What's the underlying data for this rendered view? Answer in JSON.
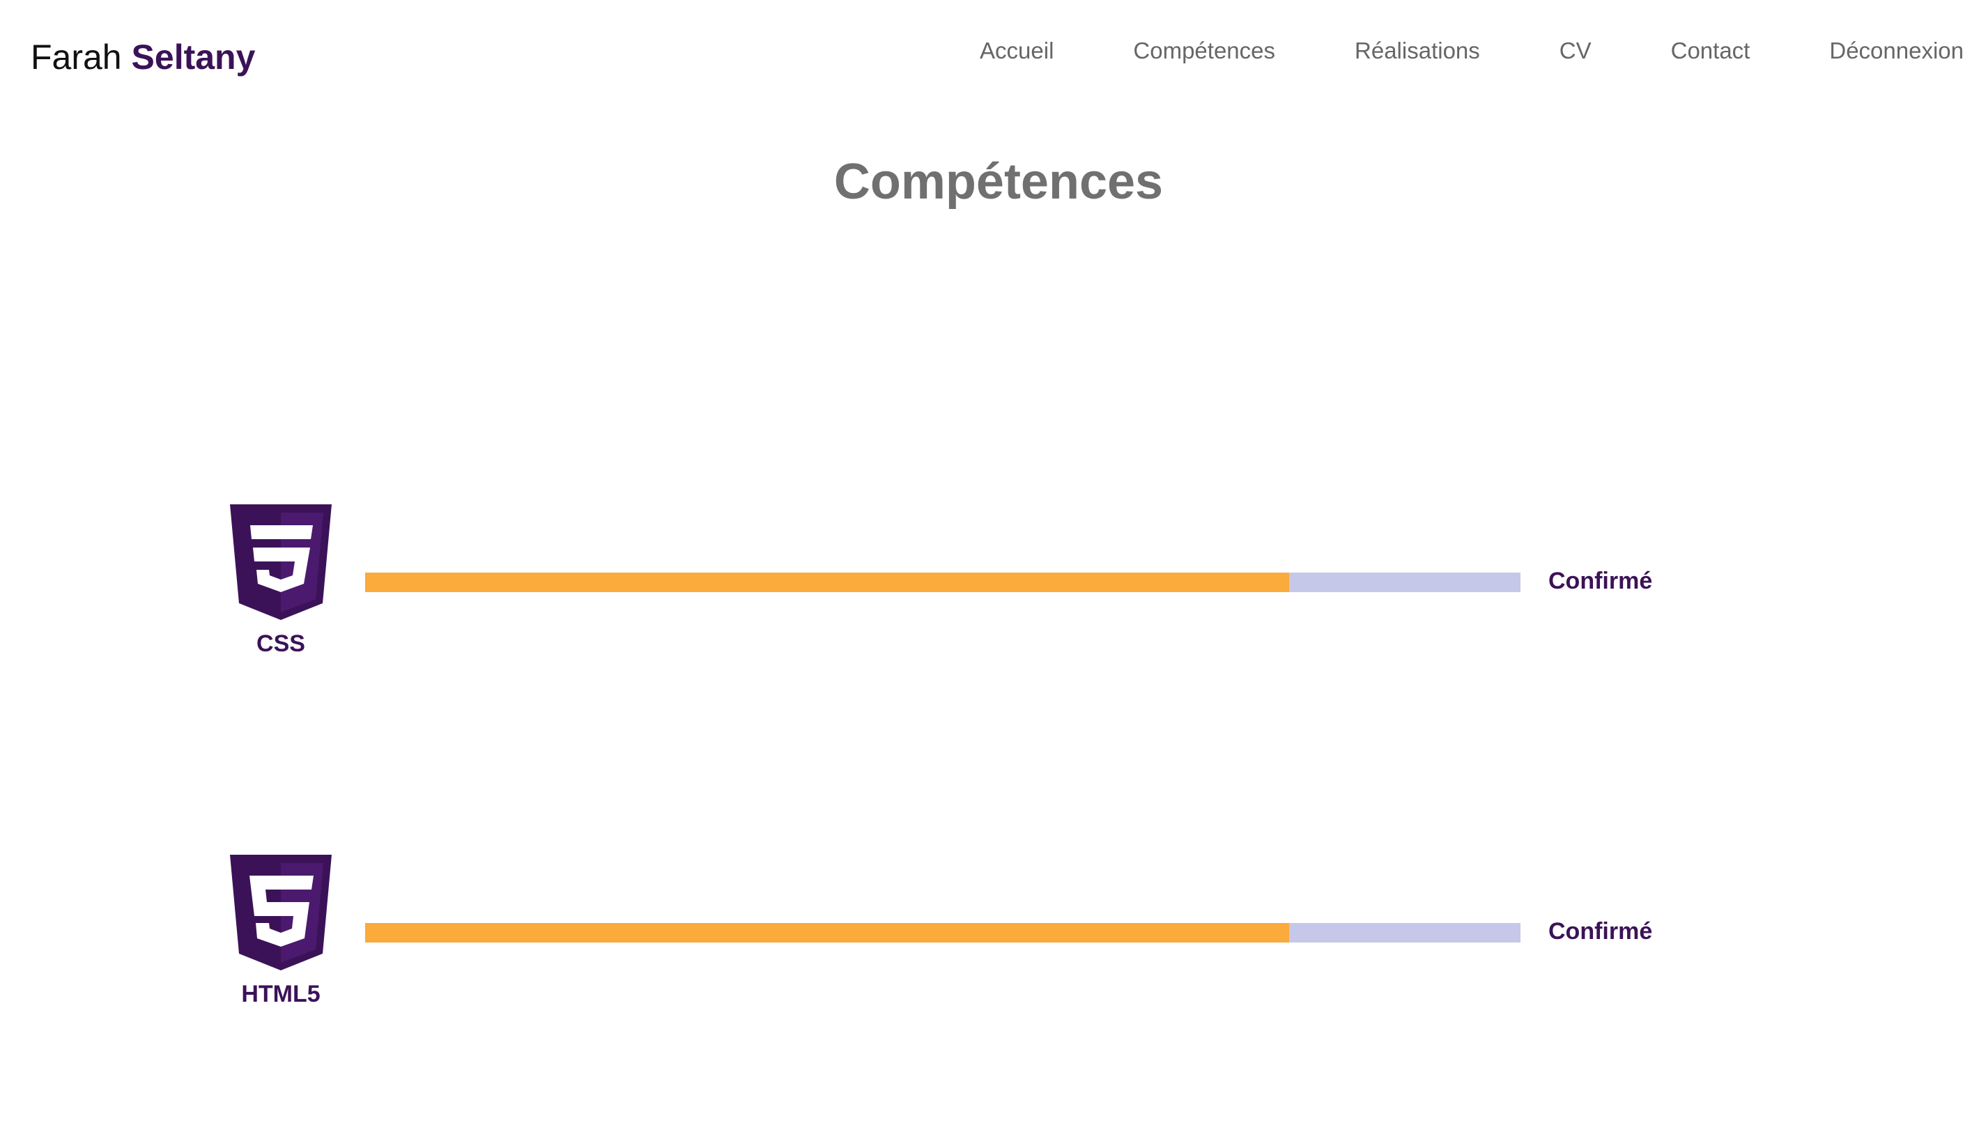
{
  "header": {
    "brand_first": "Farah",
    "brand_last": "Seltany",
    "nav": [
      {
        "label": "Accueil"
      },
      {
        "label": "Compétences"
      },
      {
        "label": "Réalisations"
      },
      {
        "label": "CV"
      },
      {
        "label": "Contact"
      },
      {
        "label": "Déconnexion"
      }
    ]
  },
  "main": {
    "title": "Compétences",
    "skills": [
      {
        "name": "CSS",
        "icon": "css3-icon",
        "level": "Confirmé",
        "progress": 0.8
      },
      {
        "name": "HTML5",
        "icon": "html5-icon",
        "level": "Confirmé",
        "progress": 0.8
      }
    ]
  },
  "colors": {
    "brand_accent": "#3b1258",
    "bar_fill": "#fbaa3c",
    "bar_track": "#c5c8e8",
    "title": "#707070",
    "nav_text": "#666666"
  }
}
